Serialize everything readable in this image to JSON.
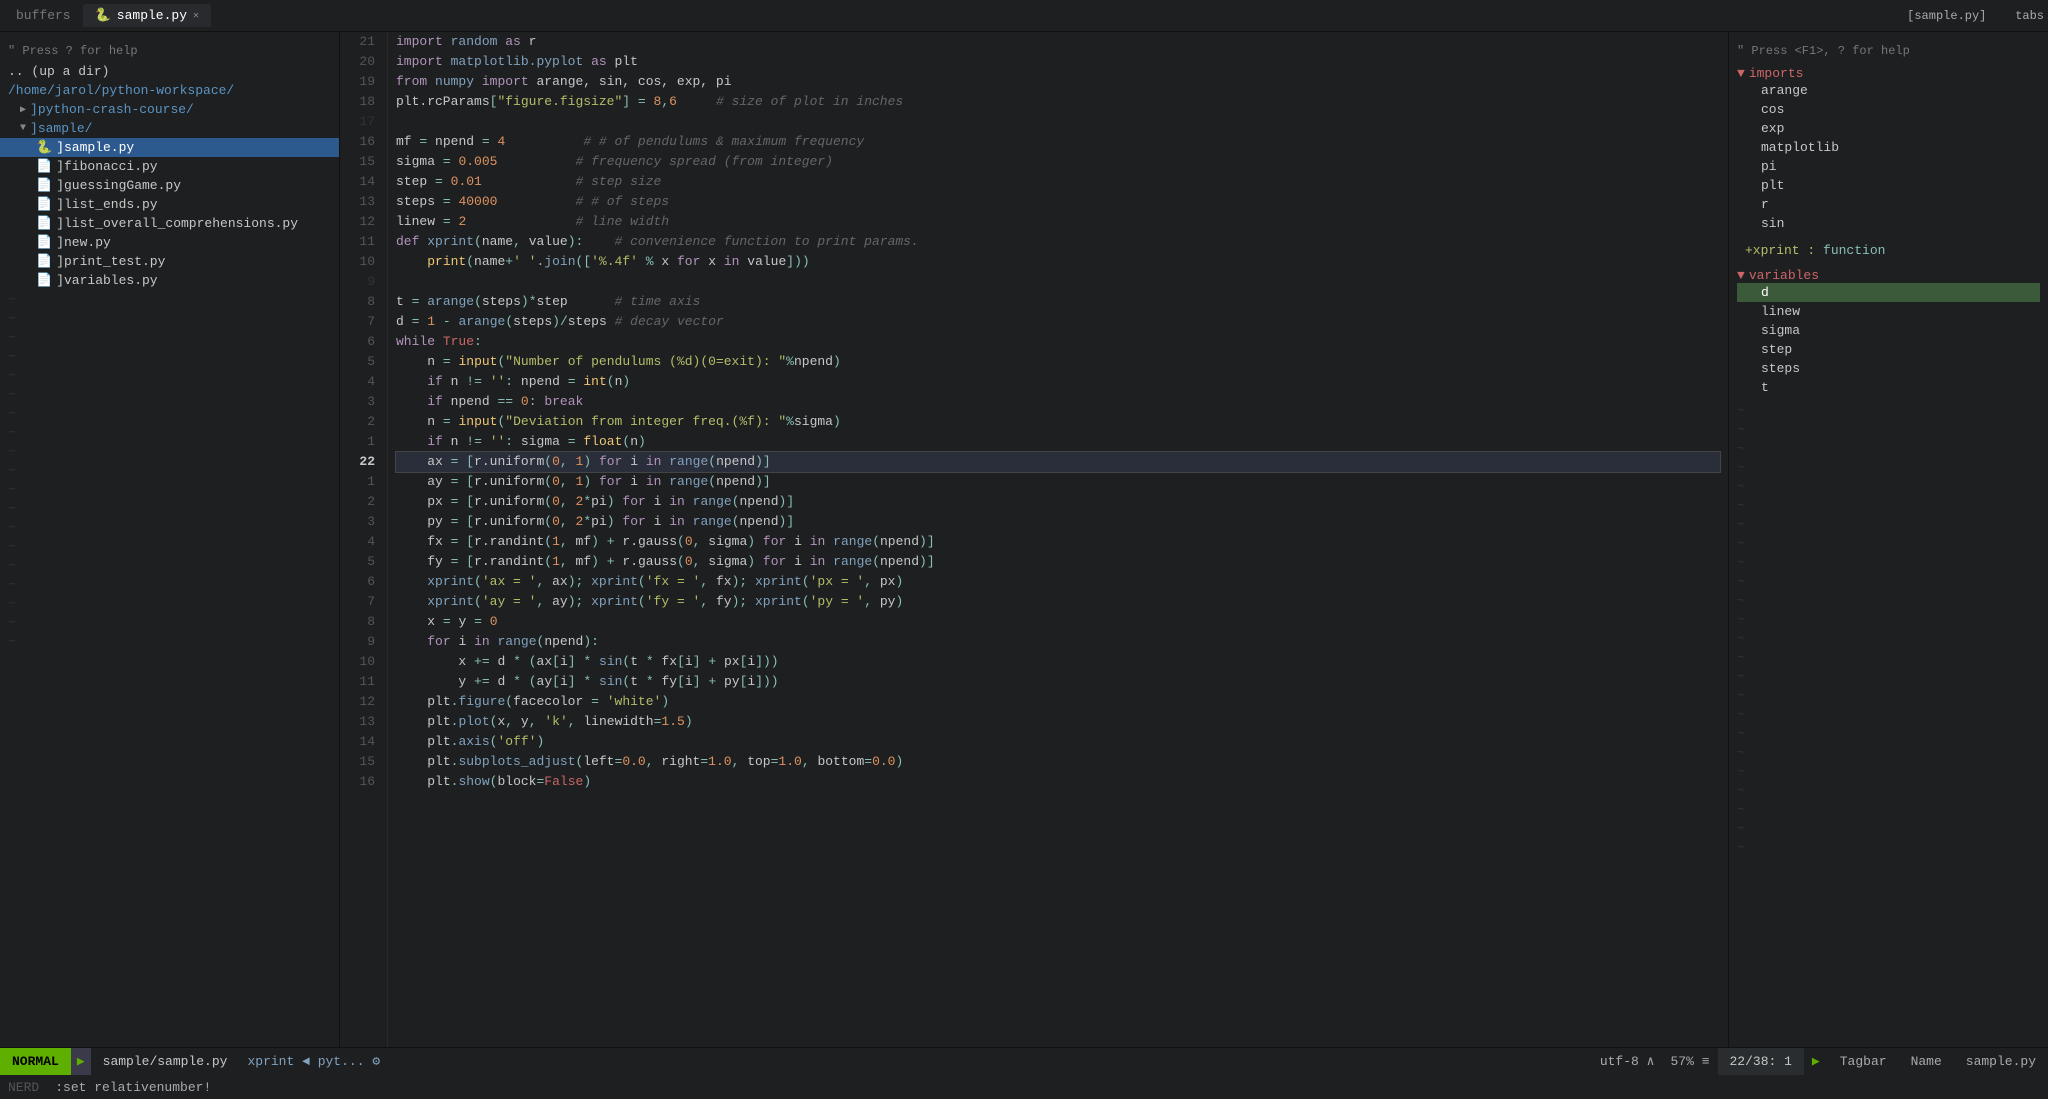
{
  "tabs": {
    "left_label": "buffers",
    "active_tab": "sample.py",
    "active_tab_icon": "✕",
    "right_label": "[sample.py]",
    "right_suffix": "tabs"
  },
  "sidebar": {
    "help": "\" Press ? for help",
    "up_dir": ".. (up a dir)",
    "root": "/home/jarol/python-workspace/",
    "items": [
      {
        "label": "]python-crash-course/",
        "type": "dir",
        "indent": 1
      },
      {
        "label": "]sample/",
        "type": "dir",
        "indent": 1,
        "expanded": true
      },
      {
        "label": "]sample.py",
        "type": "file-py",
        "indent": 2,
        "selected": true
      },
      {
        "label": "]fibonacci.py",
        "type": "file",
        "indent": 2
      },
      {
        "label": "]guessingGame.py",
        "type": "file",
        "indent": 2
      },
      {
        "label": "]list_ends.py",
        "type": "file",
        "indent": 2
      },
      {
        "label": "]list_overall_comprehensions.py",
        "type": "file",
        "indent": 2
      },
      {
        "label": "]new.py",
        "type": "file",
        "indent": 2
      },
      {
        "label": "]print_test.py",
        "type": "file",
        "indent": 2
      },
      {
        "label": "]variables.py",
        "type": "file",
        "indent": 2
      }
    ]
  },
  "code": {
    "lines": [
      {
        "num": 21,
        "text": "import random as r"
      },
      {
        "num": 20,
        "text": "import matplotlib.pyplot as plt"
      },
      {
        "num": 19,
        "text": "from numpy import arange, sin, cos, exp, pi"
      },
      {
        "num": 18,
        "text": "plt.rcParams[\"figure.figsize\"] = 8,6     # size of plot in inches"
      },
      {
        "num": 17,
        "text": ""
      },
      {
        "num": 16,
        "text": "mf = npend = 4          # # of pendulums & maximum frequency"
      },
      {
        "num": 15,
        "text": "sigma = 0.005          # frequency spread (from integer)"
      },
      {
        "num": 14,
        "text": "step = 0.01            # step size"
      },
      {
        "num": 13,
        "text": "steps = 40000          # # of steps"
      },
      {
        "num": 12,
        "text": "linew = 2              # line width"
      },
      {
        "num": 11,
        "text": "def xprint(name, value):    # convenience function to print params."
      },
      {
        "num": 10,
        "text": "    print(name+' '.join(['%.4f' % x for x in value]))"
      },
      {
        "num": 9,
        "text": ""
      },
      {
        "num": 8,
        "text": "t = arange(steps)*step      # time axis"
      },
      {
        "num": 7,
        "text": "d = 1 - arange(steps)/steps # decay vector"
      },
      {
        "num": 6,
        "text": "while True:"
      },
      {
        "num": 5,
        "text": "    n = input(\"Number of pendulums (%d)(0=exit): \"%npend)"
      },
      {
        "num": 4,
        "text": "    if n != '': npend = int(n)"
      },
      {
        "num": 3,
        "text": "    if npend == 0: break"
      },
      {
        "num": 2,
        "text": "    n = input(\"Deviation from integer freq.(%f): \"%sigma)"
      },
      {
        "num": 1,
        "text": "    if n != '': sigma = float(n)"
      },
      {
        "num": 22,
        "text": "    ax = [r.uniform(0, 1) for i in range(npend)]",
        "cursor": true
      },
      {
        "num": 1,
        "text": "    ay = [r.uniform(0, 1) for i in range(npend)]"
      },
      {
        "num": 2,
        "text": "    px = [r.uniform(0, 2*pi) for i in range(npend)]"
      },
      {
        "num": 3,
        "text": "    py = [r.uniform(0, 2*pi) for i in range(npend)]"
      },
      {
        "num": 4,
        "text": "    fx = [r.randint(1, mf) + r.gauss(0, sigma) for i in range(npend)]"
      },
      {
        "num": 5,
        "text": "    fy = [r.randint(1, mf) + r.gauss(0, sigma) for i in range(npend)]"
      },
      {
        "num": 6,
        "text": "    xprint('ax = ', ax); xprint('fx = ', fx); xprint('px = ', px)"
      },
      {
        "num": 7,
        "text": "    xprint('ay = ', ay); xprint('fy = ', fy); xprint('py = ', py)"
      },
      {
        "num": 8,
        "text": "    x = y = 0"
      },
      {
        "num": 9,
        "text": "    for i in range(npend):"
      },
      {
        "num": 10,
        "text": "        x += d * (ax[i] * sin(t * fx[i] + px[i]))"
      },
      {
        "num": 11,
        "text": "        y += d * (ay[i] * sin(t * fy[i] + py[i]))"
      },
      {
        "num": 12,
        "text": "    plt.figure(facecolor = 'white')"
      },
      {
        "num": 13,
        "text": "    plt.plot(x, y, 'k', linewidth=1.5)"
      },
      {
        "num": 14,
        "text": "    plt.axis('off')"
      },
      {
        "num": 15,
        "text": "    plt.subplots_adjust(left=0.0, right=1.0, top=1.0, bottom=0.0)"
      },
      {
        "num": 16,
        "text": "    plt.show(block=False)"
      }
    ]
  },
  "right_panel": {
    "help": "\" Press <F1>, ? for help",
    "imports_section": "imports",
    "imports": [
      "arange",
      "cos",
      "exp",
      "matplotlib",
      "pi",
      "plt",
      "r",
      "sin"
    ],
    "xprint_label": "+xprint : function",
    "variables_section": "variables",
    "variables": [
      "d",
      "linew",
      "sigma",
      "step",
      "steps",
      "t"
    ]
  },
  "status_bar": {
    "mode": "NORMAL",
    "file": "sample/sample.py",
    "func": "xprint",
    "arrow": "◄",
    "pyt": "pyt...",
    "icon": "⚙",
    "encoding": "utf-8",
    "line_ending": "∧",
    "percent": "57%",
    "equals": "≡",
    "position": "22/38",
    "col": ": 1",
    "right1": "Tagbar",
    "right2": "Name",
    "right3": "sample.py"
  },
  "cmd_line": {
    "text": ":set relativenumber!"
  },
  "nerd_label": "NERD"
}
